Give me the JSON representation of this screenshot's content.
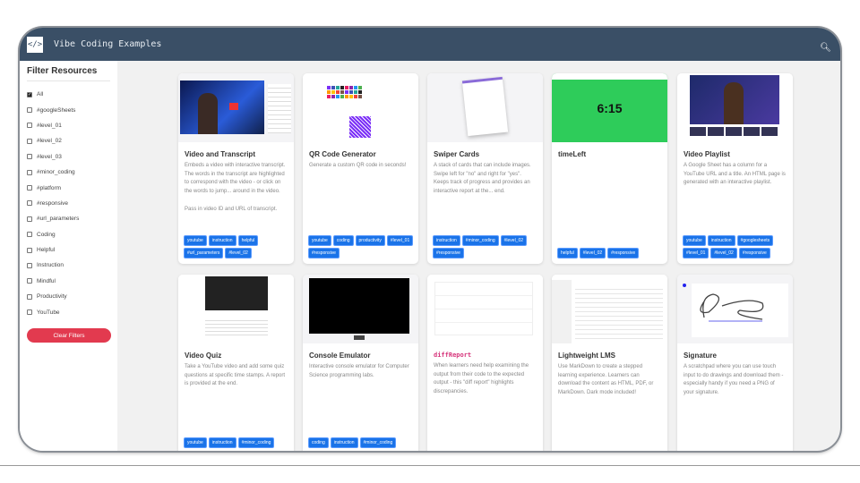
{
  "header": {
    "title": "Vibe Coding Examples",
    "logo_icon": "code-icon",
    "search_icon": "search-icon"
  },
  "sidebar": {
    "title": "Filter Resources",
    "filters": [
      {
        "label": "All",
        "checked": true
      },
      {
        "label": "#googleSheets",
        "checked": false
      },
      {
        "label": "#level_01",
        "checked": false
      },
      {
        "label": "#level_02",
        "checked": false
      },
      {
        "label": "#level_03",
        "checked": false
      },
      {
        "label": "#minor_coding",
        "checked": false
      },
      {
        "label": "#platform",
        "checked": false
      },
      {
        "label": "#responsive",
        "checked": false
      },
      {
        "label": "#url_parameters",
        "checked": false
      },
      {
        "label": "Coding",
        "checked": false
      },
      {
        "label": "Helpful",
        "checked": false
      },
      {
        "label": "Instruction",
        "checked": false
      },
      {
        "label": "Mindful",
        "checked": false
      },
      {
        "label": "Productivity",
        "checked": false
      },
      {
        "label": "YouTube",
        "checked": false
      }
    ],
    "clear_label": "Clear Filters",
    "accent": "#e23a4f"
  },
  "cards": [
    {
      "title": "Video and Transcript",
      "desc": "Embeds a video with interactive transcript. The words in the transcript are highlighted to correspond with the video - or click on the words to jump... around in the video.\n\nPass in video ID and URL of transcript.",
      "tags": [
        "youtube",
        "instruction",
        "helpful",
        "#url_parameters",
        "#level_02"
      ],
      "thumb": "video"
    },
    {
      "title": "QR Code Generator",
      "desc": "Generate a custom QR code in seconds!",
      "tags": [
        "youtube",
        "coding",
        "productivity",
        "#level_01",
        "#responsive"
      ],
      "thumb": "qr"
    },
    {
      "title": "Swiper Cards",
      "desc": "A stack of cards that can include images. Swipe left for \"no\" and right for \"yes\". Keeps track of progress and provides an interactive report at the... end.",
      "tags": [
        "instruction",
        "#minor_coding",
        "#level_02",
        "#responsive"
      ],
      "thumb": "swiper"
    },
    {
      "title": "timeLeft",
      "desc": "",
      "tags": [
        "helpful",
        "#level_02",
        "#responsive"
      ],
      "thumb": "timer",
      "timer_text": "6:15"
    },
    {
      "title": "Video Playlist",
      "desc": "A Google Sheet has a column for a YouTube URL and a title. An HTML page is generated with an interactive playlist.",
      "tags": [
        "youtube",
        "instruction",
        "#googlesheets",
        "#level_01",
        "#level_02",
        "#responsive"
      ],
      "thumb": "playlist"
    },
    {
      "title": "Video Quiz",
      "desc": "Take a YouTube video and add some quiz questions at specific time stamps. A report is provided at the end.",
      "tags": [
        "youtube",
        "instruction",
        "#minor_coding"
      ],
      "thumb": "quiz"
    },
    {
      "title": "Console Emulator",
      "desc": "Interactive console emulator for Computer Science programming labs.",
      "tags": [
        "coding",
        "instruction",
        "#minor_coding"
      ],
      "thumb": "console"
    },
    {
      "title": "diffReport",
      "desc": "When learners need help examining the output from their code to the expected output - this \"diff report\" highlights discrepancies.",
      "tags": [],
      "thumb": "diff",
      "mono": true
    },
    {
      "title": "Lightweight LMS",
      "desc": "Use MarkDown to create a stepped learning experience. Learners can download the content as HTML, PDF, or MarkDown. Dark mode included!",
      "tags": [],
      "thumb": "lms"
    },
    {
      "title": "Signature",
      "desc": "A scratchpad where you can use touch input to do drawings and download them - especially handy if you need a PNG of your signature.",
      "tags": [],
      "thumb": "signature"
    }
  ],
  "colors": {
    "header": "#3a4f66",
    "tag": "#1a73e8",
    "timer_green": "#2ecc5a"
  }
}
